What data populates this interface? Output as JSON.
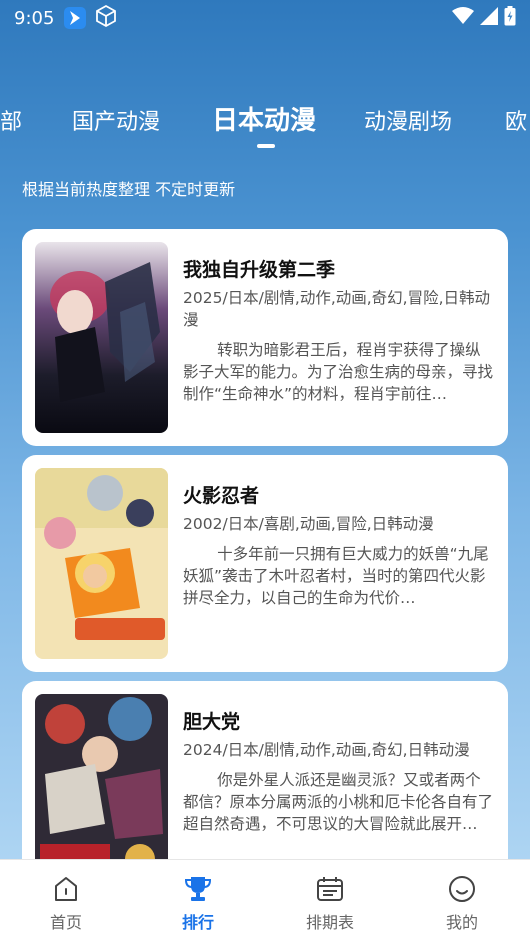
{
  "status_bar": {
    "time": "9:05"
  },
  "tabs": [
    {
      "label": "部"
    },
    {
      "label": "国产动漫"
    },
    {
      "label": "日本动漫"
    },
    {
      "label": "动漫剧场"
    },
    {
      "label": "欧"
    }
  ],
  "active_tab": "日本动漫",
  "subtitle": "根据当前热度整理 不定时更新",
  "items": [
    {
      "title": "我独自升级第二季",
      "meta": "2025/日本/剧情,动作,动画,奇幻,冒险,日韩动漫",
      "desc": "转职为暗影君王后，程肖宇获得了操纵影子大军的能力。为了治愈生病的母亲，寻找制作“生命神水”的材料，程肖宇前往…"
    },
    {
      "title": "火影忍者",
      "meta": "2002/日本/喜剧,动画,冒险,日韩动漫",
      "desc": "十多年前一只拥有巨大威力的妖兽“九尾妖狐”袭击了木叶忍者村，当时的第四代火影拼尽全力，以自己的生命为代价…"
    },
    {
      "title": "胆大党",
      "meta": "2024/日本/剧情,动作,动画,奇幻,日韩动漫",
      "desc": "你是外星人派还是幽灵派？又或者两个都信？原本分属两派的小桃和厄卡伦各自有了超自然奇遇，不可思议的大冒险就此展开…"
    }
  ],
  "bottom_nav": [
    {
      "label": "首页",
      "icon": "home-icon"
    },
    {
      "label": "排行",
      "icon": "trophy-icon"
    },
    {
      "label": "排期表",
      "icon": "calendar-icon"
    },
    {
      "label": "我的",
      "icon": "smiley-icon"
    }
  ],
  "colors": {
    "accent": "#1a73e8",
    "background_top": "#2f79bd",
    "background_bottom": "#b9dcf6"
  }
}
